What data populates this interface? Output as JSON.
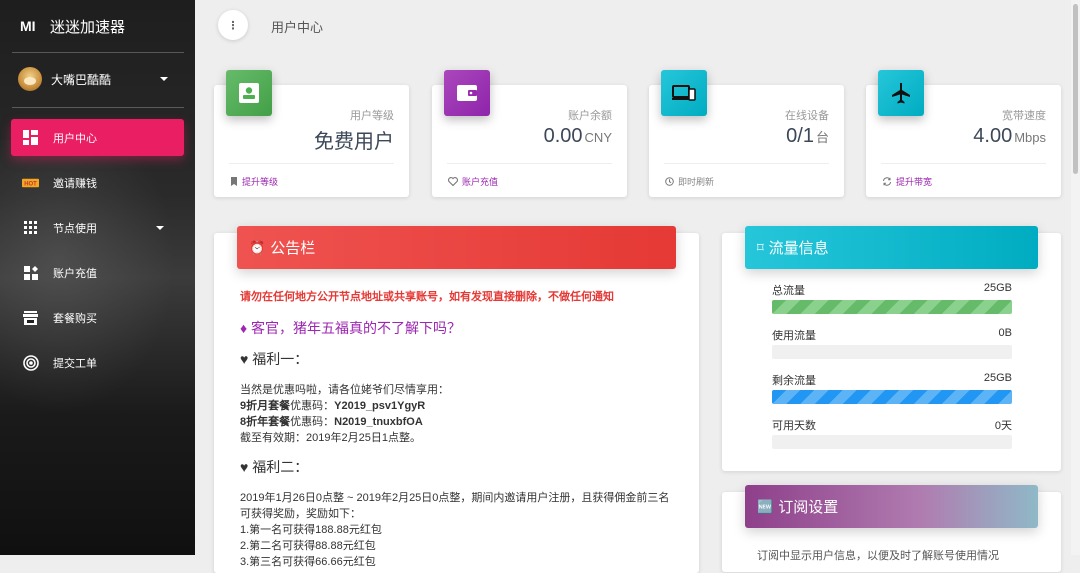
{
  "brand": {
    "mini": "MI",
    "name": "迷迷加速器"
  },
  "user": {
    "name": "大嘴巴酷酷"
  },
  "nav": [
    {
      "label": "用户中心",
      "icon": "dashboard-icon"
    },
    {
      "label": "邀请赚钱",
      "icon": "hot-icon"
    },
    {
      "label": "节点使用",
      "icon": "grid-icon"
    },
    {
      "label": "账户充值",
      "icon": "widgets-icon"
    },
    {
      "label": "套餐购买",
      "icon": "store-icon"
    },
    {
      "label": "提交工单",
      "icon": "target-icon"
    }
  ],
  "header": {
    "title": "用户中心"
  },
  "stats": [
    {
      "category": "用户等级",
      "value": "免费用户",
      "unit": "",
      "footer": "提升等级",
      "color": "#4caf50"
    },
    {
      "category": "账户余额",
      "value": "0.00",
      "unit": "CNY",
      "footer": "账户充值",
      "color": "#9c27b0"
    },
    {
      "category": "在线设备",
      "value": "0/1",
      "unit": "台",
      "footer": "即时刷新",
      "color": "#00bcd4"
    },
    {
      "category": "宽带速度",
      "value": "4.00",
      "unit": "Mbps",
      "footer": "提升带宽",
      "color": "#00bcd4"
    }
  ],
  "announcement": {
    "title": "公告栏",
    "warning": "请勿在任何地方公开节点地址或共享账号，如有发现直接删除，不做任何通知",
    "headline": "♦ 客官，猪年五福真的不了解下吗？",
    "welfare1": "♥ 福利一：",
    "w1_intro": "当然是优惠吗啦，请各位姥爷们尽情享用：",
    "w1_line1_bold": "9折月套餐",
    "w1_line1_rest": "优惠码：",
    "w1_line1_code": "Y2019_psv1YgyR",
    "w1_line2_bold": "8折年套餐",
    "w1_line2_rest": "优惠码：",
    "w1_line2_code": "N2019_tnuxbfOA",
    "w1_expiry": "截至有效期：2019年2月25日1点整。",
    "welfare2": "♥ 福利二：",
    "w2_text": "2019年1月26日0点整 ~ 2019年2月25日0点整，期间内邀请用户注册，且获得佣金前三名可获得奖励，奖励如下：",
    "w2_r1": "1.第一名可获得188.88元红包",
    "w2_r2": "2.第二名可获得88.88元红包",
    "w2_r3": "3.第三名可获得66.66元红包"
  },
  "traffic": {
    "title": "流量信息",
    "rows": [
      {
        "label": "总流量",
        "value": "25GB",
        "percent": 100,
        "style": "green"
      },
      {
        "label": "使用流量",
        "value": "0B",
        "percent": 0,
        "style": "green"
      },
      {
        "label": "剩余流量",
        "value": "25GB",
        "percent": 100,
        "style": "blue"
      },
      {
        "label": "可用天数",
        "value": "0天",
        "percent": 0,
        "style": "blue"
      }
    ]
  },
  "subscription": {
    "title": "订阅设置",
    "text": "订阅中显示用户信息，以便及时了解账号使用情况"
  },
  "colors": {
    "active": "#e91e63",
    "announcement": "#ef5350",
    "traffic": "#26c6da",
    "subscription": "#8e5a9e"
  }
}
